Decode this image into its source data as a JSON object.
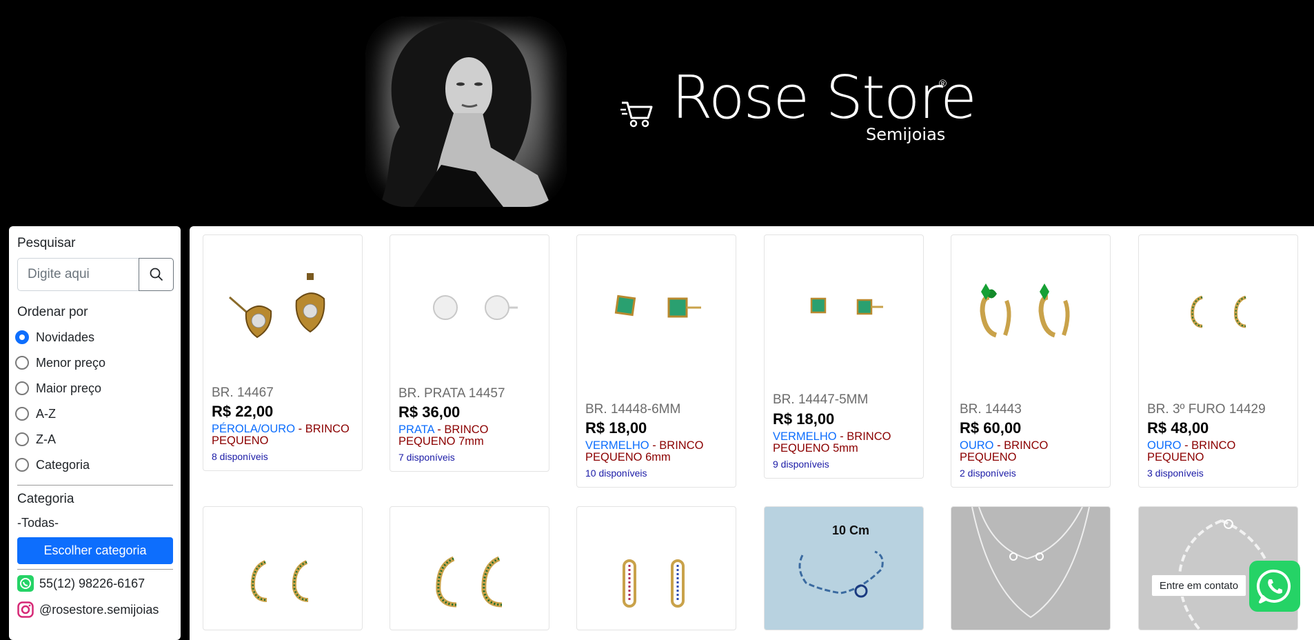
{
  "header": {
    "brand_name": "Rose Store",
    "brand_registered": "®",
    "brand_subtitle": "Semijoias"
  },
  "sidebar": {
    "search_label": "Pesquisar",
    "search_placeholder": "Digite aqui",
    "sort_label": "Ordenar por",
    "sort_options": [
      {
        "label": "Novidades",
        "checked": true
      },
      {
        "label": "Menor preço",
        "checked": false
      },
      {
        "label": "Maior preço",
        "checked": false
      },
      {
        "label": "A-Z",
        "checked": false
      },
      {
        "label": "Z-A",
        "checked": false
      },
      {
        "label": "Categoria",
        "checked": false
      }
    ],
    "category_label": "Categoria",
    "category_current": "-Todas-",
    "category_button": "Escolher categoria",
    "phone": "55(12) 98226-6167",
    "instagram": "@rosestore.semijoias"
  },
  "products": [
    {
      "code": "BR. 14467",
      "price": "R$ 22,00",
      "color": "PÉROLA/OURO",
      "sep": " - ",
      "name": "BRINCO PEQUENO",
      "stock": "8 disponíveis",
      "image": "pearl-heart-stud-earrings"
    },
    {
      "code": "BR. PRATA 14457",
      "price": "R$ 36,00",
      "color": "PRATA",
      "sep": " - ",
      "name": "BRINCO PEQUENO 7mm",
      "stock": "7 disponíveis",
      "image": "crystal-stud-earrings"
    },
    {
      "code": "BR. 14448-6MM",
      "price": "R$ 18,00",
      "color": "VERMELHO",
      "sep": " - ",
      "name": "BRINCO PEQUENO 6mm",
      "stock": "10 disponíveis",
      "image": "green-square-stud-earrings"
    },
    {
      "code": "BR. 14447-5MM",
      "price": "R$ 18,00",
      "color": "VERMELHO",
      "sep": " - ",
      "name": "BRINCO PEQUENO 5mm",
      "stock": "9 disponíveis",
      "image": "small-green-square-stud-earrings"
    },
    {
      "code": "BR. 14443",
      "price": "R$ 60,00",
      "color": "OURO",
      "sep": " - ",
      "name": "BRINCO PEQUENO",
      "stock": "2 disponíveis",
      "image": "green-heart-hoop-earrings"
    },
    {
      "code": "BR. 3º FURO 14429",
      "price": "R$ 48,00",
      "color": "OURO",
      "sep": " - ",
      "name": "BRINCO PEQUENO",
      "stock": "3 disponíveis",
      "image": "green-half-hoop-earrings"
    }
  ],
  "second_row_images": [
    "green-half-hoop-earrings",
    "green-half-hoop-earrings-large",
    "rainbow-hoop-earrings",
    "extender-chain",
    "silver-layered-necklace",
    "silver-chain-bracelet"
  ],
  "extender_caption": "10 Cm",
  "whatsapp": {
    "tooltip": "Entre em contato",
    "icon": "whatsapp-icon"
  },
  "colors": {
    "primary": "#0d6efd",
    "product_name": "#8b0000",
    "stock": "#1a1aa6",
    "whatsapp": "#25d366"
  }
}
